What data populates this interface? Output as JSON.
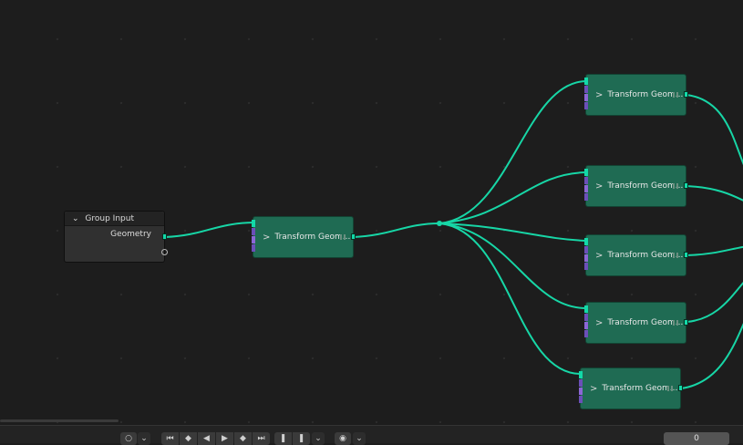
{
  "group_input": {
    "title": "Group Input",
    "output_label": "Geometry"
  },
  "nodes": {
    "center_label": "Transform Geom...",
    "right_labels": [
      "Transform Geom...",
      "Transform Geom...",
      "Transform Geom...",
      "Transform Geom...",
      "Transform Geom..."
    ]
  },
  "colors": {
    "link": "#17d6a6",
    "node_body": "#1f6b53",
    "socket_geometry": "#12d9a8",
    "socket_vector": "#6b4fb8",
    "socket_rotation": "#8c66d6"
  },
  "icons": {
    "expand": "chevron-right-icon",
    "collapse": "chevron-down-icon"
  },
  "timeline": {
    "current_frame": "0",
    "buttons": [
      "jump-start",
      "prev-keyframe",
      "play-reverse",
      "play",
      "next-keyframe",
      "jump-end"
    ]
  }
}
